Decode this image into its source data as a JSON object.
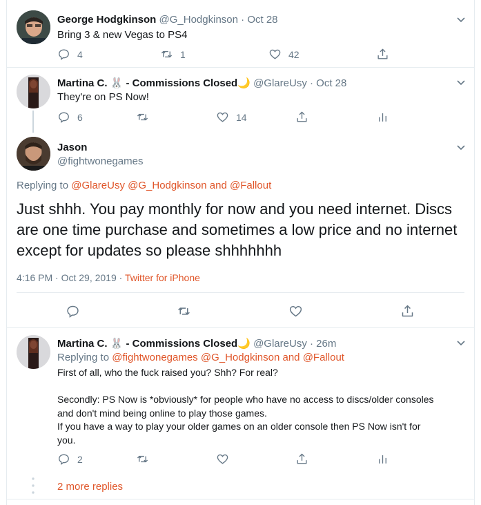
{
  "tweets": [
    {
      "name": "George Hodgkinson",
      "handle": "@G_Hodgkinson",
      "sep": "·",
      "time": "Oct 28",
      "text": "Bring 3 & new Vegas to PS4",
      "replies": "4",
      "retweets": "1",
      "likes": "42"
    },
    {
      "name": "Martina C. 🐰 - Commissions Closed🌙",
      "handle": "@GlareUsy",
      "sep": "·",
      "time": "Oct 28",
      "text": "They're on PS Now!",
      "replies": "6",
      "retweets": "",
      "likes": "14"
    }
  ],
  "focus": {
    "name": "Jason",
    "handle": "@fightwonegames",
    "replying_prefix": "Replying to",
    "replying_to": [
      "@GlareUsy",
      "@G_Hodgkinson",
      "and",
      "@Fallout"
    ],
    "text": "Just shhh. You pay monthly for now and you need internet. Discs are one time purchase and sometimes a low price and no internet except for updates so please shhhhhhh",
    "meta_time": "4:16 PM · Oct 29, 2019",
    "meta_sep": "·",
    "meta_source": "Twitter for iPhone"
  },
  "reply": {
    "name": "Martina C. 🐰 - Commissions Closed🌙",
    "handle": "@GlareUsy",
    "sep": "·",
    "time": "26m",
    "replying_prefix": "Replying to",
    "replying_to": [
      "@fightwonegames",
      "@G_Hodgkinson",
      "and",
      "@Fallout"
    ],
    "lines": [
      "First of all, who the fuck raised you? Shh? For real?",
      "",
      "Secondly: PS Now is *obviously* for people who have no access to discs/older consoles",
      "and don't mind being online to play those games.",
      "If you have a way to play your older games on an older console then PS Now isn't for",
      "you."
    ],
    "replies": "2"
  },
  "more_replies": "2 more replies",
  "colors": {
    "accent": "#e0562a",
    "text": "#14171a",
    "muted": "#657786",
    "border": "#e6ecf0"
  }
}
